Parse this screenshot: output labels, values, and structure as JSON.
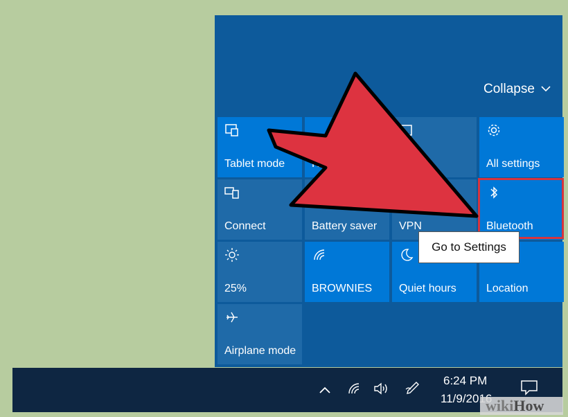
{
  "action_center": {
    "collapse_label": "Collapse",
    "tiles": [
      {
        "label": "Tablet mode",
        "icon": "tablet-mode-icon",
        "state": "on"
      },
      {
        "label": "Rota",
        "icon": "rotation-lock-icon",
        "state": "on"
      },
      {
        "label": "",
        "icon": "note-icon",
        "state": "off"
      },
      {
        "label": "All settings",
        "icon": "gear-icon",
        "state": "on"
      },
      {
        "label": "Connect",
        "icon": "connect-icon",
        "state": "off"
      },
      {
        "label": "Battery saver",
        "icon": "battery-saver-icon",
        "state": "off"
      },
      {
        "label": "VPN",
        "icon": "vpn-icon",
        "state": "off"
      },
      {
        "label": "Bluetooth",
        "icon": "bluetooth-icon",
        "state": "on"
      },
      {
        "label": "25%",
        "icon": "brightness-icon",
        "state": "off"
      },
      {
        "label": "BROWNIES",
        "icon": "wifi-icon",
        "state": "on"
      },
      {
        "label": "Quiet hours",
        "icon": "moon-icon",
        "state": "on"
      },
      {
        "label": "Location",
        "icon": "location-icon",
        "state": "on"
      },
      {
        "label": "Airplane mode",
        "icon": "airplane-icon",
        "state": "off"
      }
    ],
    "tooltip": "Go to Settings"
  },
  "taskbar": {
    "time": "6:24 PM",
    "date": "11/9/2016",
    "tray_icons": [
      "chevron-up-icon",
      "wifi-icon",
      "volume-icon",
      "pen-icon",
      "notification-icon"
    ]
  },
  "watermark": {
    "part1": "wiki",
    "part2": "How"
  },
  "colors": {
    "tile_on": "#0078d7",
    "tile_off": "#1f6aa8",
    "panel_bg": "#0d5a9b",
    "taskbar_bg": "#0e2642",
    "highlight": "#d5343e",
    "arrow": "#dd3340",
    "page_bg": "#b7cc9f"
  }
}
